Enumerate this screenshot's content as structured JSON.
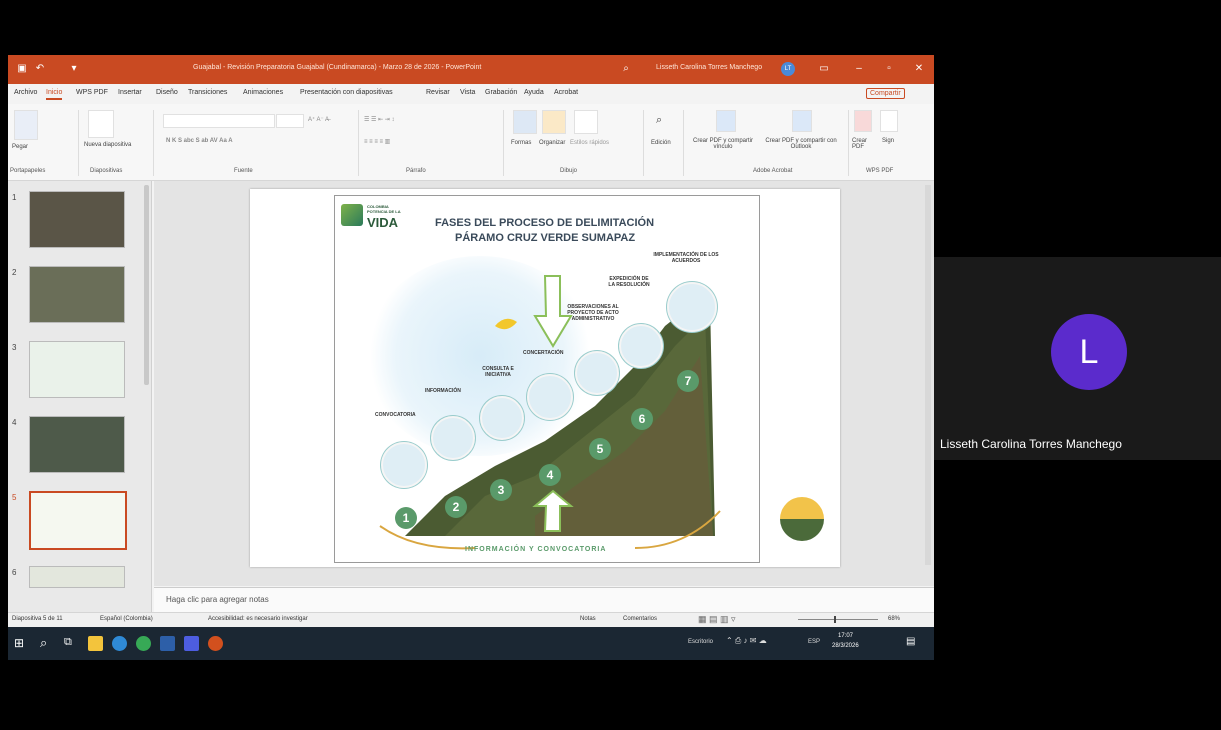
{
  "window": {
    "title": "Guajabal - Revisión Preparatoria Guajabal (Cundinamarca) - Marzo 28 de 2026 - PowerPoint",
    "user": "Lisseth Carolina Torres Manchego",
    "user_initial": "LT"
  },
  "ribbon_tabs": [
    "Archivo",
    "Inicio",
    "WPS PDF",
    "Insertar",
    "Diseño",
    "Transiciones",
    "Animaciones",
    "Presentación con diapositivas",
    "Revisar",
    "Vista",
    "Grabación",
    "Ayuda",
    "Acrobat"
  ],
  "share_label": "Compartir",
  "ribbon_groups": {
    "clipboard": "Portapapeles",
    "paste": "Pegar",
    "slides": "Diapositivas",
    "new_slide": "Nueva diapositiva",
    "font": "Fuente",
    "paragraph": "Párrafo",
    "drawing": "Dibujo",
    "shapes": "Formas",
    "arrange": "Organizar",
    "quick_styles": "Estilos rápidos",
    "editing": "Edición",
    "acrobat": "Adobe Acrobat",
    "create_pdf_share": "Crear PDF y compartir vínculo",
    "create_pdf_outlook": "Crear PDF y compartir con Outlook",
    "wps_pdf": "WPS PDF",
    "create_pdf": "Crear PDF",
    "sign": "Sign"
  },
  "thumbnails": [
    {
      "num": "1",
      "color": "#5a5547"
    },
    {
      "num": "2",
      "color": "#6a6e58"
    },
    {
      "num": "3",
      "color": "#eaf2ea"
    },
    {
      "num": "4",
      "color": "#4e5a4a"
    },
    {
      "num": "5",
      "color": "#f5f8f0"
    },
    {
      "num": "6",
      "color": "#e3e7dd"
    }
  ],
  "slide": {
    "logo_small": "COLOMBIA POTENCIA DE LA",
    "logo_big": "VIDA",
    "title_line1": "FASES DEL PROCESO DE DELIMITACIÓN",
    "title_line2": "PÁRAMO CRUZ VERDE SUMAPAZ",
    "footer": "INFORMACIÓN Y CONVOCATORIA",
    "phases": [
      {
        "n": "1",
        "label": "CONVOCATORIA"
      },
      {
        "n": "2",
        "label": "INFORMACIÓN"
      },
      {
        "n": "3",
        "label": "CONSULTA E INICIATIVA"
      },
      {
        "n": "4",
        "label": "CONCERTACIÓN"
      },
      {
        "n": "5",
        "label": "OBSERVACIONES AL PROYECTO DE ACTO ADMINISTRATIVO"
      },
      {
        "n": "6",
        "label": "EXPEDICIÓN DE LA RESOLUCIÓN"
      },
      {
        "n": "7",
        "label": "IMPLEMENTACIÓN DE LOS ACUERDOS"
      }
    ]
  },
  "notes_placeholder": "Haga clic para agregar notas",
  "status": {
    "slide_counter": "Diapositiva 5 de 11",
    "language": "Español (Colombia)",
    "accessibility": "Accesibilidad: es necesario investigar",
    "notes_btn": "Notas",
    "comments_btn": "Comentarios",
    "zoom": "68%"
  },
  "taskbar": {
    "clock_time": "17:07",
    "clock_date": "28/3/2026",
    "lang": "ESP",
    "desktop_label": "Escritorio"
  },
  "colors": {
    "titlebar": "#c94a22",
    "avatar": "#5b2bcc",
    "phase_green": "#5a9a6a"
  }
}
